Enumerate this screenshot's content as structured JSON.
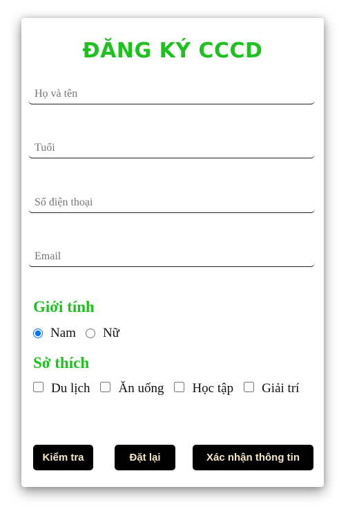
{
  "form": {
    "title": "ĐĂNG KÝ CCCD",
    "fields": {
      "name_placeholder": "Họ và tên",
      "age_placeholder": "Tuổi",
      "phone_placeholder": "Số điện thoại",
      "email_placeholder": "Email",
      "name_value": "",
      "age_value": "",
      "phone_value": "",
      "email_value": ""
    },
    "gender": {
      "title": "Giới tính",
      "options": [
        {
          "label": "Nam",
          "checked": true
        },
        {
          "label": "Nữ",
          "checked": false
        }
      ]
    },
    "hobbies": {
      "title": "Sở thích",
      "options": [
        {
          "label": "Du lịch",
          "checked": false
        },
        {
          "label": "Ăn uống",
          "checked": false
        },
        {
          "label": "Học tập",
          "checked": false
        },
        {
          "label": "Giải trí",
          "checked": false
        }
      ]
    },
    "buttons": {
      "check": "Kiểm tra",
      "reset": "Đặt lại",
      "confirm": "Xác nhận thông tin"
    },
    "colors": {
      "accent": "#1ec21e",
      "button_bg": "#000000",
      "button_text": "#f5e6c8"
    }
  }
}
